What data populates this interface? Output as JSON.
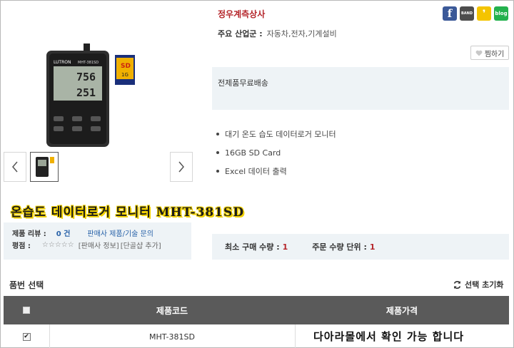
{
  "shop": {
    "name": "정우계측상사"
  },
  "share": [
    {
      "name": "facebook-icon",
      "glyph": "f",
      "color": "#3b5998"
    },
    {
      "name": "band-icon",
      "glyph": "BAND",
      "color": "#4d4d4d"
    },
    {
      "name": "kakaostory-icon",
      "glyph": "❜",
      "color": "#f4c400"
    },
    {
      "name": "blog-icon",
      "glyph": "blog",
      "color": "#23b14d"
    }
  ],
  "industry": {
    "label": "주요 산업군 :",
    "value": "자동차,전자,기계설비"
  },
  "wish": {
    "label": "찜하기",
    "icon": "heart-icon"
  },
  "shipping": {
    "text": "전제품무료배송"
  },
  "features": [
    "대기 온도 습도 데이터로거 모니터",
    "16GB SD Card",
    "Excel 데이터 출력"
  ],
  "product": {
    "title": "온습도 데이터로거 모니터 MHT-381SD",
    "device_brand": "LUTRON",
    "device_model": "MHT-381SD",
    "device_reading_1": "756",
    "device_reading_2": "251",
    "sd_card_label": "SD",
    "sd_card_size": "1G"
  },
  "review": {
    "review_label": "제품 리뷰 :",
    "review_count": "0 건",
    "inquiry_link": "판매사 제품/기술 문의",
    "rating_label": "평점 :",
    "stars": "☆☆☆☆☆",
    "seller_info": "[판매사 정보]",
    "favorite_add": "[단골샵 추가]"
  },
  "quantity": {
    "min_label": "최소 구매 수량 :",
    "min_value": "1",
    "unit_label": "주문 수량 단위 :",
    "unit_value": "1"
  },
  "options": {
    "title": "품번 선택",
    "reset_label": "선택 초기화",
    "headers": {
      "code": "제품코드",
      "price": "제품가격"
    },
    "rows": [
      {
        "checked": true,
        "code": "MHT-381SD"
      }
    ]
  },
  "caption": "다아라몰에서 확인 가능 합니다"
}
